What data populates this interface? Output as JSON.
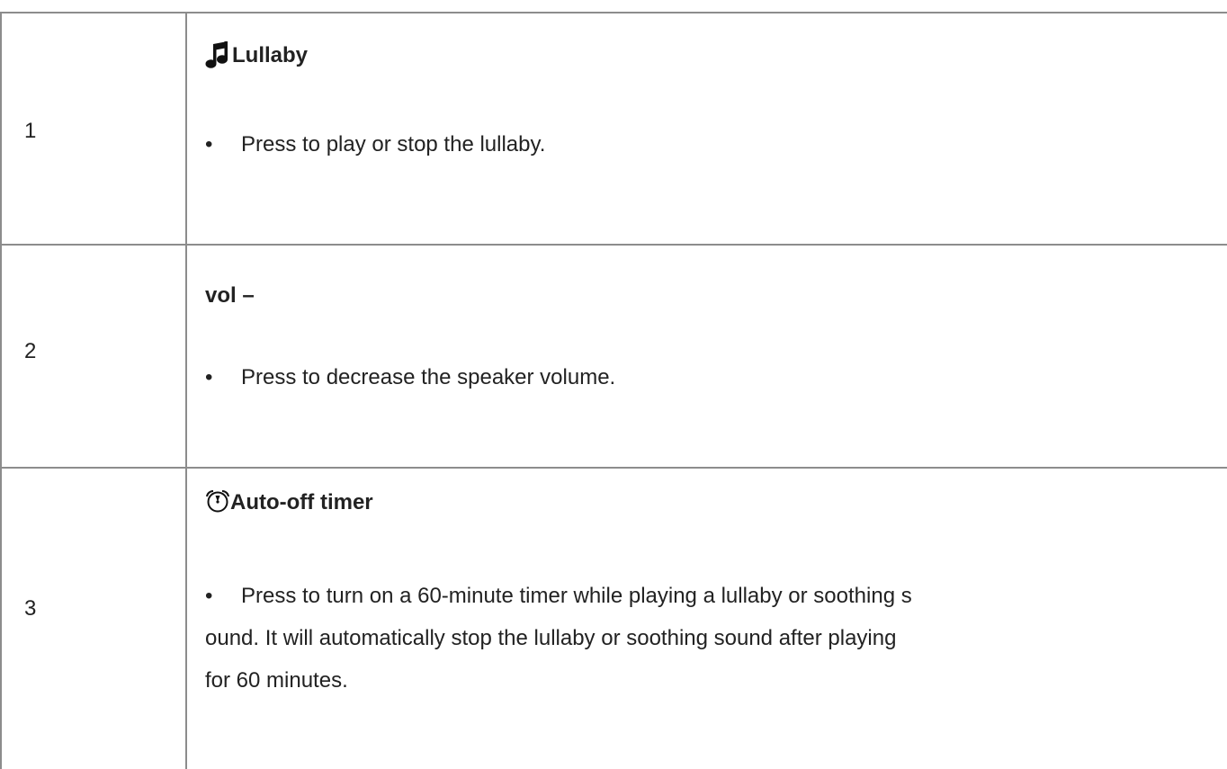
{
  "rows": [
    {
      "number": "1",
      "icon": "music-note-icon",
      "title": "Lullaby",
      "bullet_glyph": "•",
      "text": "Press to play or stop the lullaby."
    },
    {
      "number": "2",
      "title": "vol –",
      "bullet_glyph": "•",
      "text": "Press to decrease the speaker volume."
    },
    {
      "number": "3",
      "icon": "alarm-clock-icon",
      "title": "Auto-off timer",
      "bullet_glyph": "•",
      "text_line1": "Press to turn on a 60-minute timer while playing a lullaby or soothing s",
      "text_line2": "ound. It will automatically stop the lullaby or soothing sound after playing",
      "text_line3": "for 60 minutes."
    }
  ],
  "colors": {
    "border": "#8c8c8c",
    "text": "#222222"
  }
}
